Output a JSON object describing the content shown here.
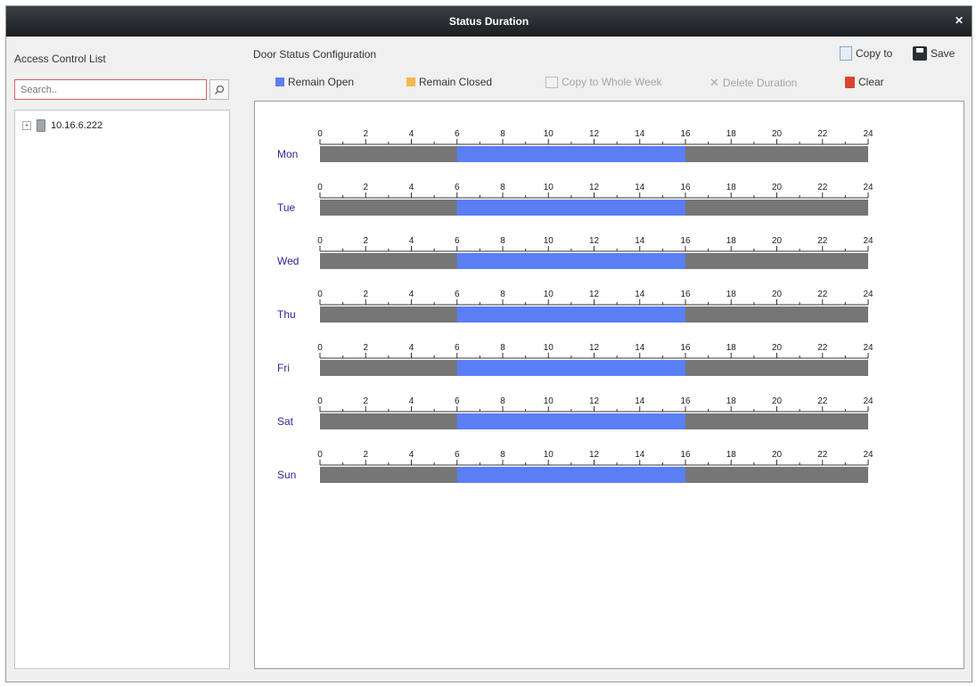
{
  "window": {
    "title": "Status Duration"
  },
  "left": {
    "title": "Access Control List",
    "search_placeholder": "Search..",
    "tree": [
      {
        "label": "10.16.6.222"
      }
    ]
  },
  "right": {
    "title": "Door Status Configuration",
    "copy_to_label": "Copy to",
    "save_label": "Save"
  },
  "toolbar": {
    "remain_open": "Remain Open",
    "remain_closed": "Remain Closed",
    "copy_whole_week": "Copy to Whole Week",
    "delete_duration": "Delete Duration",
    "clear": "Clear"
  },
  "colors": {
    "remain_open": "#5b7ef5",
    "remain_closed": "#f2b84b",
    "track": "#767676"
  },
  "schedule": {
    "ticks": [
      0,
      2,
      4,
      6,
      8,
      10,
      12,
      14,
      16,
      18,
      20,
      22,
      24
    ],
    "days": [
      {
        "label": "Mon",
        "segments": [
          {
            "start": 6,
            "end": 16,
            "status": "remain_open"
          }
        ]
      },
      {
        "label": "Tue",
        "segments": [
          {
            "start": 6,
            "end": 16,
            "status": "remain_open"
          }
        ]
      },
      {
        "label": "Wed",
        "segments": [
          {
            "start": 6,
            "end": 16,
            "status": "remain_open"
          }
        ]
      },
      {
        "label": "Thu",
        "segments": [
          {
            "start": 6,
            "end": 16,
            "status": "remain_open"
          }
        ]
      },
      {
        "label": "Fri",
        "segments": [
          {
            "start": 6,
            "end": 16,
            "status": "remain_open"
          }
        ]
      },
      {
        "label": "Sat",
        "segments": [
          {
            "start": 6,
            "end": 16,
            "status": "remain_open"
          }
        ]
      },
      {
        "label": "Sun",
        "segments": [
          {
            "start": 6,
            "end": 16,
            "status": "remain_open"
          }
        ]
      }
    ]
  }
}
